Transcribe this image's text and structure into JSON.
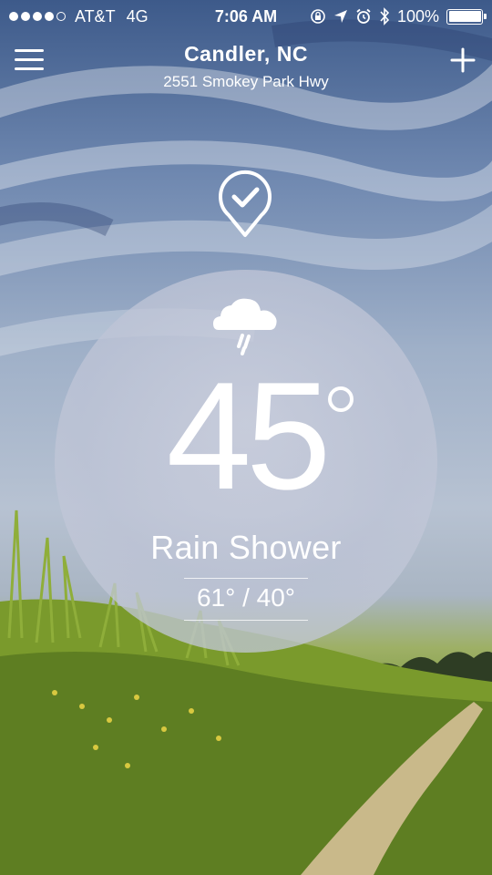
{
  "status_bar": {
    "carrier": "AT&T",
    "network": "4G",
    "time": "7:06 AM",
    "battery": "100%",
    "battery_level": 1.0,
    "signal_bars": 4,
    "icons": [
      "orientation-lock-icon",
      "location-arrow-icon",
      "alarm-icon",
      "bluetooth-icon",
      "battery-icon"
    ]
  },
  "header": {
    "location_title": "Candler, NC",
    "address": "2551 Smokey Park Hwy"
  },
  "weather": {
    "temperature": "45",
    "condition": "Rain Shower",
    "high_low": "61° / 40°"
  },
  "icons": {
    "menu": "menu-icon",
    "add": "plus-icon",
    "location_pin": "location-check-pin-icon",
    "condition": "rain-cloud-icon"
  }
}
